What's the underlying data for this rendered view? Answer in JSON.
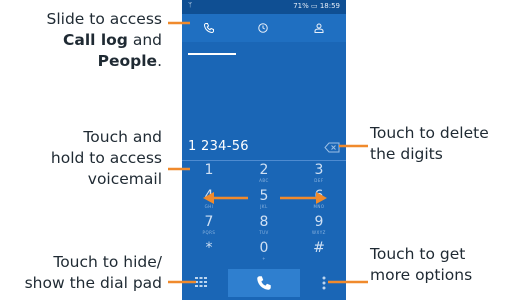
{
  "annotations": {
    "call_log": {
      "l1": "Slide to access",
      "l2_bold": "Call log",
      "l2_rest": " and",
      "l3_bold": "People",
      "l3_rest": "."
    },
    "voicemail": {
      "l1": "Touch and",
      "l2": "hold to access",
      "l3": "voicemail"
    },
    "dialpad": {
      "l1": "Touch to hide/",
      "l2": "show the dial pad"
    },
    "delete": {
      "l1": "Touch to delete",
      "l2": "the digits"
    },
    "options": {
      "l1": "Touch to get",
      "l2": "more options"
    }
  },
  "status_bar": {
    "text": "71% ▭ 18:59",
    "left_icon": "usb-icon"
  },
  "tabs": [
    {
      "label": "",
      "icon": "phone-icon",
      "selected": true
    },
    {
      "label": "",
      "icon": "clock-icon",
      "selected": false
    },
    {
      "label": "",
      "icon": "person-icon",
      "selected": false
    }
  ],
  "display": {
    "number": "1 234-56"
  },
  "keypad": [
    {
      "num": "1",
      "sub": ""
    },
    {
      "num": "2",
      "sub": "ABC"
    },
    {
      "num": "3",
      "sub": "DEF"
    },
    {
      "num": "4",
      "sub": "GHI"
    },
    {
      "num": "5",
      "sub": "JKL"
    },
    {
      "num": "6",
      "sub": "MNO"
    },
    {
      "num": "7",
      "sub": "PQRS"
    },
    {
      "num": "8",
      "sub": "TUV"
    },
    {
      "num": "9",
      "sub": "WXYZ"
    },
    {
      "num": "*",
      "sub": ""
    },
    {
      "num": "0",
      "sub": "+"
    },
    {
      "num": "#",
      "sub": ""
    }
  ],
  "colors": {
    "screen": "#1a66b6",
    "accent": "#f08a2c",
    "text": "#1f2a33"
  }
}
